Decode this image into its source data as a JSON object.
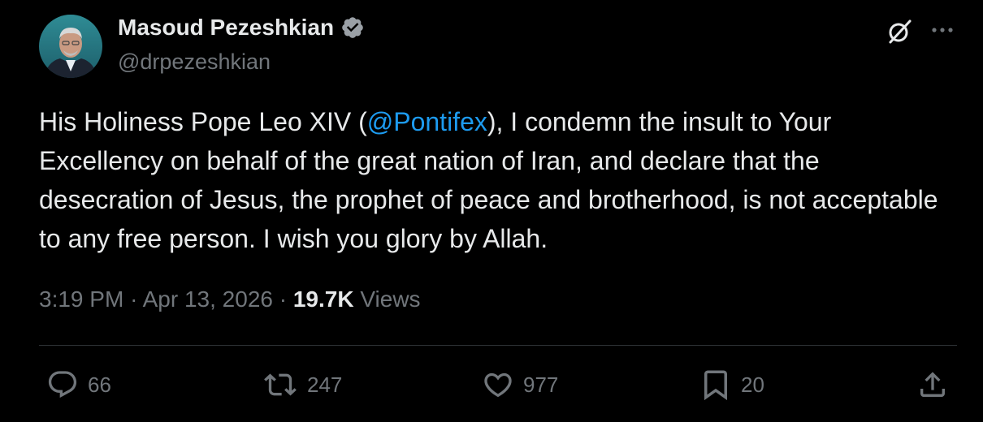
{
  "author": {
    "name": "Masoud Pezeshkian",
    "handle": "@drpezeshkian",
    "verified_badge": "verified-badge-icon"
  },
  "tweet": {
    "text_before": "His Holiness Pope Leo XIV (",
    "mention": "@Pontifex",
    "text_after": "), I condemn the insult to Your Excellency on behalf of the great nation of Iran, and declare that the desecration of Jesus, the prophet of peace and brotherhood, is not acceptable to any free person. I wish you glory by Allah."
  },
  "meta": {
    "time": "3:19 PM",
    "date": "Apr 13, 2026",
    "separator": "·",
    "views_count": "19.7K",
    "views_label": "Views"
  },
  "actions": {
    "reply": {
      "icon": "reply-icon",
      "count": "66"
    },
    "repost": {
      "icon": "repost-icon",
      "count": "247"
    },
    "like": {
      "icon": "heart-icon",
      "count": "977"
    },
    "bookmark": {
      "icon": "bookmark-icon",
      "count": "20"
    },
    "share": {
      "icon": "share-icon"
    }
  },
  "header_buttons": {
    "grok": "grok-icon",
    "more": "more-icon"
  },
  "colors": {
    "background": "#000000",
    "text": "#e7e9ea",
    "secondary": "#71767b",
    "link": "#1d9bf0",
    "divider": "#2f3336"
  }
}
